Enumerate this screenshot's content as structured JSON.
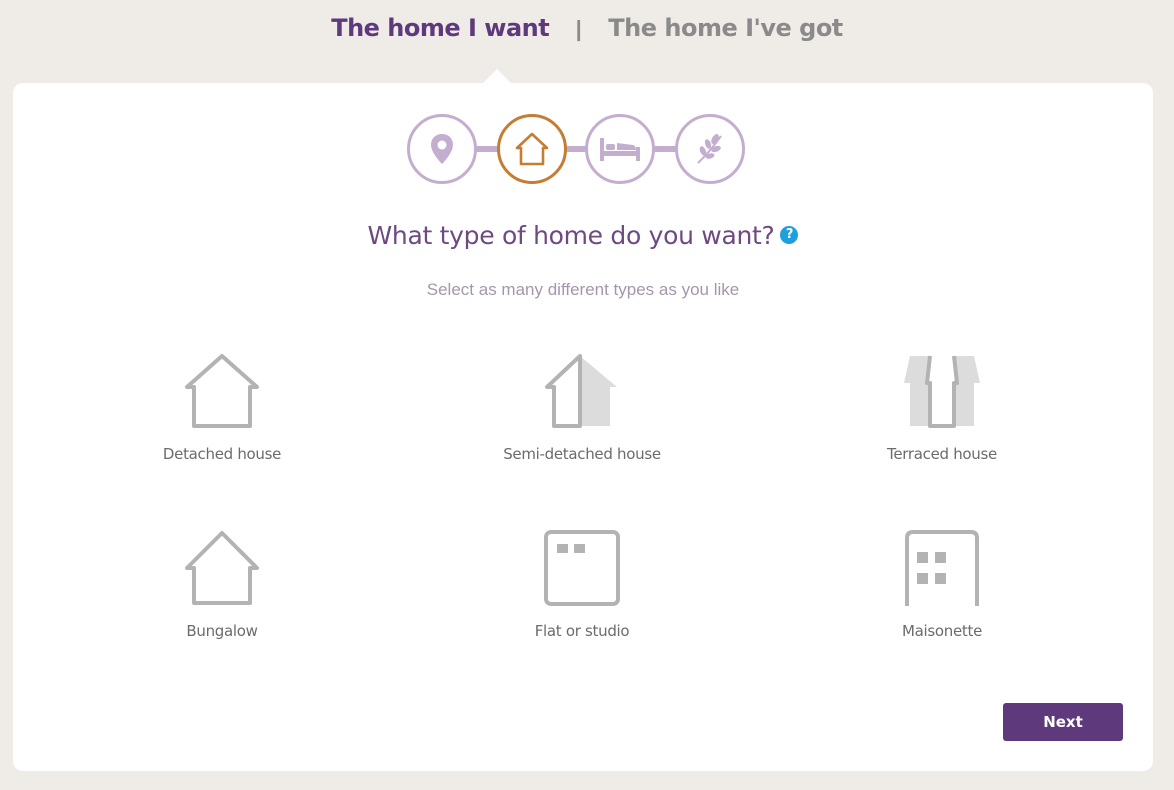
{
  "tabs": {
    "active_label": "The home I want",
    "separator": "|",
    "inactive_label": "The home I've got"
  },
  "steps": [
    {
      "icon": "location-pin-icon",
      "state": "inactive"
    },
    {
      "icon": "house-icon",
      "state": "active"
    },
    {
      "icon": "bed-icon",
      "state": "inactive"
    },
    {
      "icon": "leaf-icon",
      "state": "inactive"
    }
  ],
  "question": {
    "title": "What type of home do you want?",
    "help": "?"
  },
  "subtitle": "Select as many different types as you like",
  "options": [
    {
      "label": "Detached house",
      "icon": "detached-house-icon"
    },
    {
      "label": "Semi-detached house",
      "icon": "semi-detached-house-icon"
    },
    {
      "label": "Terraced house",
      "icon": "terraced-house-icon"
    },
    {
      "label": "Bungalow",
      "icon": "bungalow-icon"
    },
    {
      "label": "Flat or studio",
      "icon": "flat-icon"
    },
    {
      "label": "Maisonette",
      "icon": "maisonette-icon"
    }
  ],
  "next_label": "Next",
  "colors": {
    "purple": "#5e3a7c",
    "step_inactive": "#c4aed0",
    "step_active": "#c47d33",
    "icon_grey": "#b3b3b3",
    "help_blue": "#1e9fe0"
  }
}
